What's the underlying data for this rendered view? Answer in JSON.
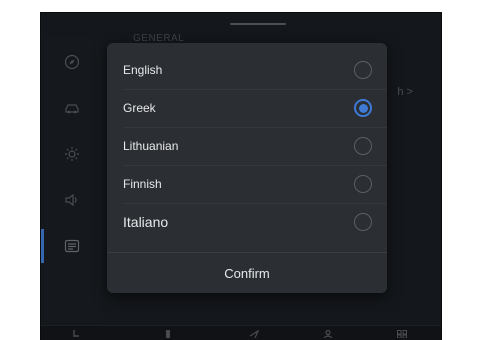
{
  "background": {
    "section_heading": "GENERAL",
    "current_value": "h  >"
  },
  "language_dialog": {
    "options": [
      {
        "label": "English",
        "selected": false
      },
      {
        "label": "Greek",
        "selected": true
      },
      {
        "label": "Lithuanian",
        "selected": false
      },
      {
        "label": "Finnish",
        "selected": false
      },
      {
        "label": "Italiano",
        "selected": false
      }
    ],
    "confirm_label": "Confirm"
  },
  "colors": {
    "accent": "#3f7ad6",
    "dialog_bg": "#2b2e33",
    "screen_bg": "#14171b"
  }
}
